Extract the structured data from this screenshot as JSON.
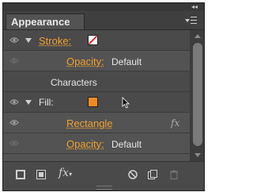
{
  "panel": {
    "title": "Appearance",
    "close_glyph": "×",
    "collapse_glyph": "◂◂",
    "menu_icon": "panel-menu-icon"
  },
  "rows": {
    "stroke": {
      "label": "Stroke:",
      "swatch": "none-with-red-slash"
    },
    "stroke_opacity": {
      "label": "Opacity:",
      "value": "Default"
    },
    "characters": {
      "label": "Characters"
    },
    "fill": {
      "label": "Fill:",
      "swatch_color": "#f08a24"
    },
    "rectangle": {
      "label": "Rectangle",
      "fx": "fx"
    },
    "fill_opacity": {
      "label": "Opacity:",
      "value": "Default"
    }
  },
  "footer": {
    "buttons": [
      "add-new-stroke",
      "add-new-fill",
      "add-new-effect",
      "clear-appearance",
      "duplicate-item",
      "delete-item"
    ],
    "fx_label": "fx"
  },
  "colors": {
    "accent": "#f0a030",
    "panel_bg": "#535353",
    "row_bg": "#4a4a4a"
  }
}
